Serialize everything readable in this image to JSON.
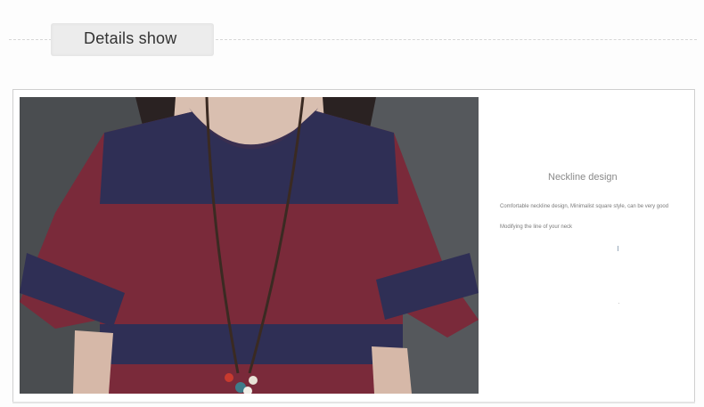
{
  "header": {
    "title": "Details show"
  },
  "detail": {
    "heading": "Neckline design",
    "description_line1": "Comfortable neckline design, Minimalist square style, can be very good",
    "description_line2": "Modifying the line of your neck"
  },
  "colors": {
    "shirt_red": "#7a2a3a",
    "shirt_navy": "#2f2f55",
    "background_gray": "#4a4d50"
  }
}
